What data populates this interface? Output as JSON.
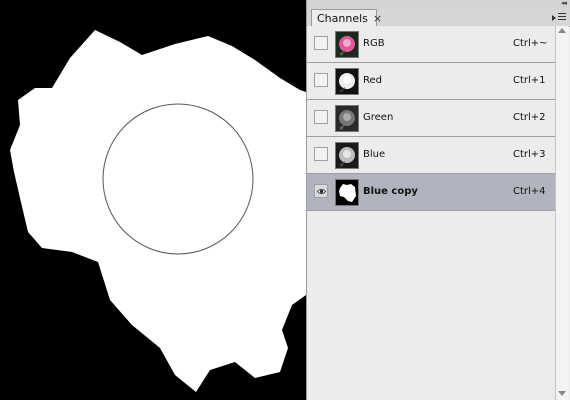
{
  "panel": {
    "tab_label": "Channels",
    "close_glyph": "×",
    "collapse_glyph": "◂◂",
    "menu_icon": "panel-menu-icon"
  },
  "channels": [
    {
      "name": "RGB",
      "shortcut": "Ctrl+~",
      "visible": false,
      "selected": false,
      "thumb": "color-rose"
    },
    {
      "name": "Red",
      "shortcut": "Ctrl+1",
      "visible": false,
      "selected": false,
      "thumb": "light-rose"
    },
    {
      "name": "Green",
      "shortcut": "Ctrl+2",
      "visible": false,
      "selected": false,
      "thumb": "dark-rose"
    },
    {
      "name": "Blue",
      "shortcut": "Ctrl+3",
      "visible": false,
      "selected": false,
      "thumb": "gray-rose"
    },
    {
      "name": "Blue copy",
      "shortcut": "Ctrl+4",
      "visible": true,
      "selected": true,
      "thumb": "mask"
    }
  ],
  "colors": {
    "selected_row": "#b1b3be",
    "panel_bg": "#ececec",
    "canvas_bg": "#000000",
    "mask_fg": "#ffffff",
    "rgb_rose": "#e0579a"
  }
}
